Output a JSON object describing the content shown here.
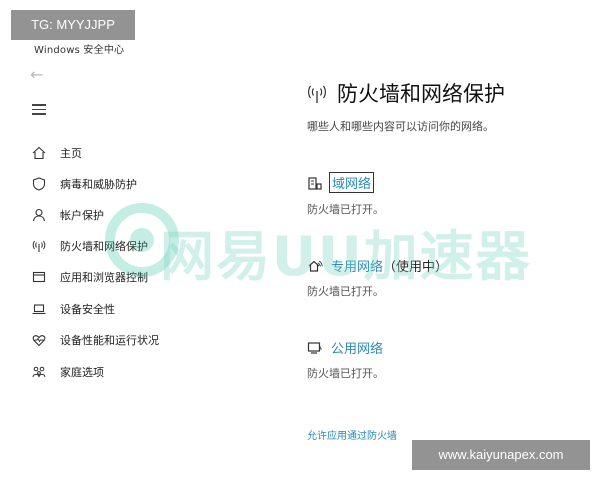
{
  "window": {
    "title": "Windows 安全中心"
  },
  "sidebar": {
    "items": [
      {
        "label": "主页",
        "icon": "home-icon"
      },
      {
        "label": "病毒和威胁防护",
        "icon": "shield-icon"
      },
      {
        "label": "帐户保护",
        "icon": "person-icon"
      },
      {
        "label": "防火墙和网络保护",
        "icon": "wifi-antenna-icon"
      },
      {
        "label": "应用和浏览器控制",
        "icon": "browser-window-icon"
      },
      {
        "label": "设备安全性",
        "icon": "laptop-icon"
      },
      {
        "label": "设备性能和运行状况",
        "icon": "heart-pulse-icon"
      },
      {
        "label": "家庭选项",
        "icon": "family-icon"
      }
    ]
  },
  "main": {
    "title": "防火墙和网络保护",
    "subtitle": "哪些人和哪些内容可以访问你的网络。",
    "networks": [
      {
        "name": "域网络",
        "extra": "",
        "status": "防火墙已打开。",
        "icon": "domain-network-icon"
      },
      {
        "name": "专用网络",
        "extra": "（使用中）",
        "status": "防火墙已打开。",
        "icon": "private-network-icon"
      },
      {
        "name": "公用网络",
        "extra": "",
        "status": "防火墙已打开。",
        "icon": "public-network-icon"
      }
    ],
    "allow_link": "允许应用通过防火墙"
  },
  "watermark": {
    "text": "网易UU加速器"
  },
  "badges": {
    "top_left": "TG: MYYJJPP",
    "bottom_right": "www.kaiyunapex.com"
  },
  "colors": {
    "link": "#2a8ab8",
    "watermark": "#7fd6c6",
    "badge_bg": "#8a8a8a"
  }
}
